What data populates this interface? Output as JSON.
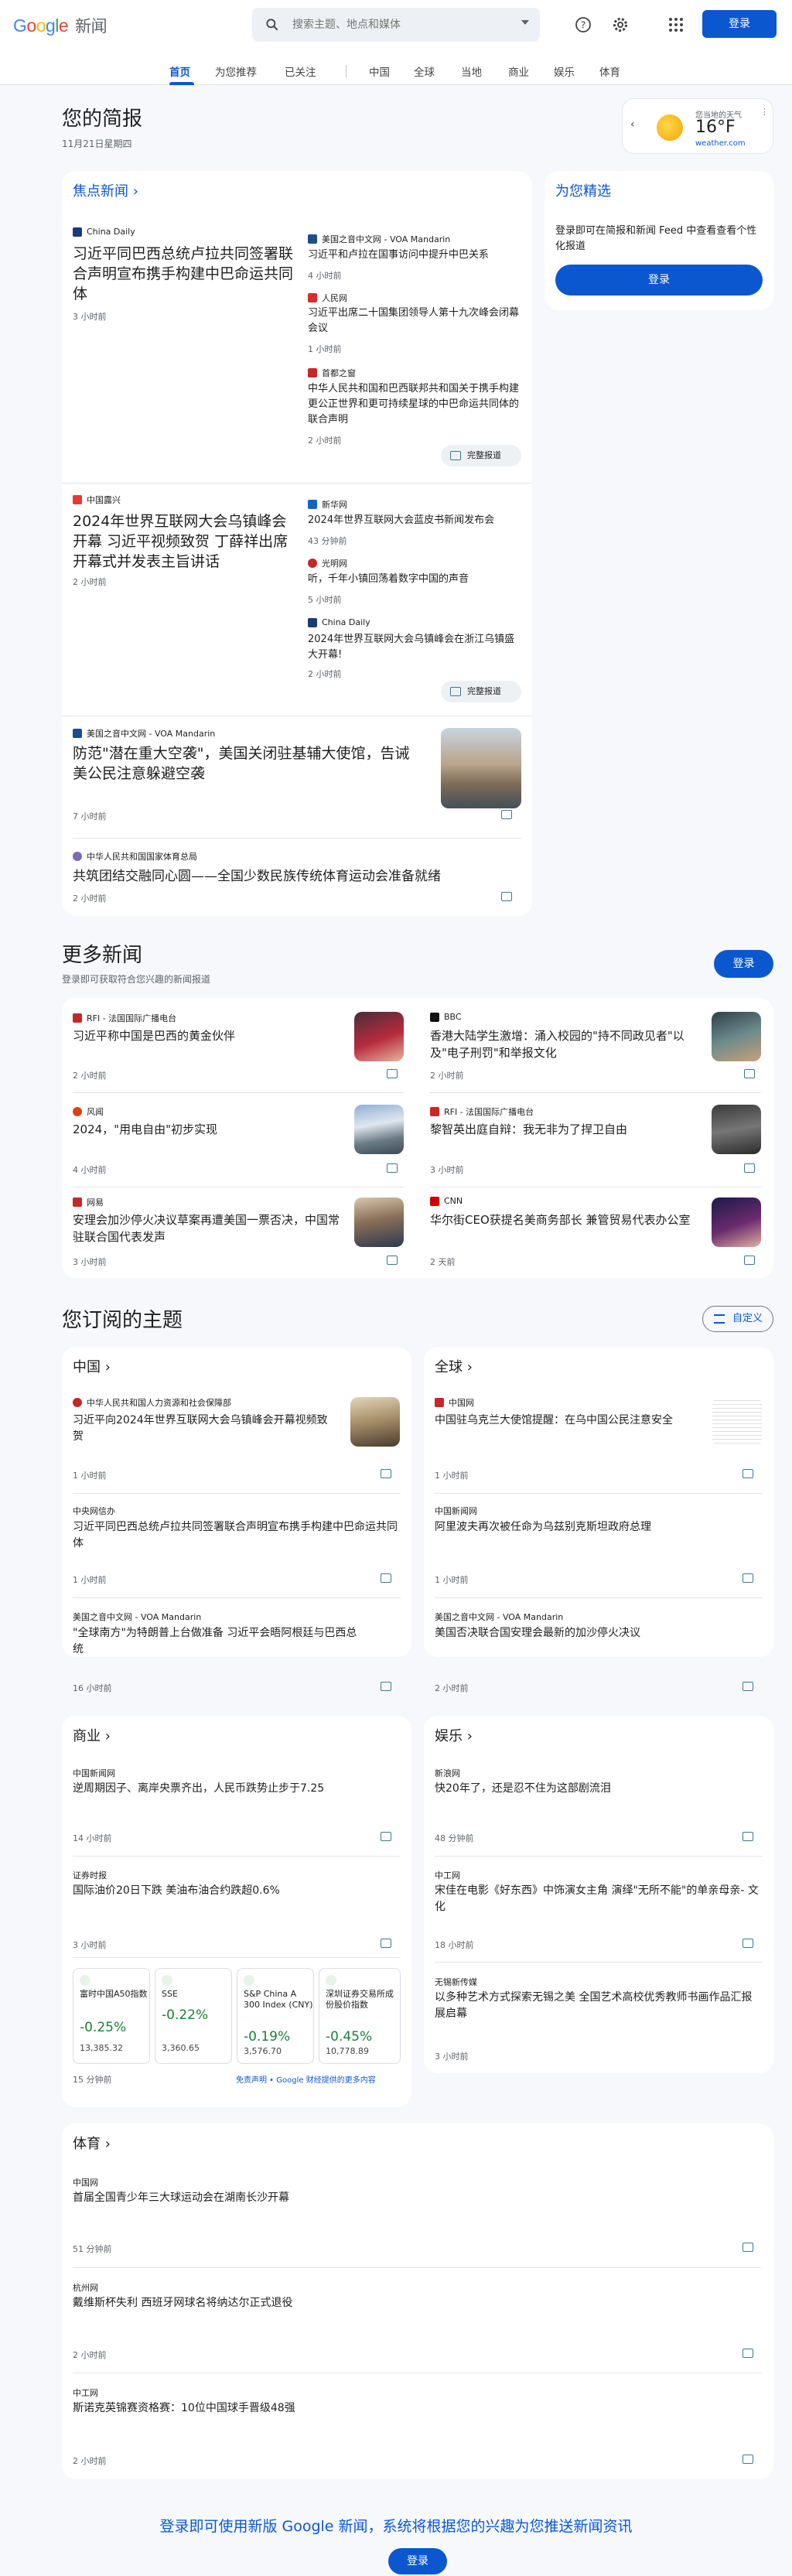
{
  "header": {
    "logo_word": "Google",
    "logo_name": "新闻",
    "search_placeholder": "搜索主题、地点和媒体",
    "signin": "登录"
  },
  "nav": [
    "首页",
    "为您推荐",
    "已关注",
    "中国",
    "全球",
    "当地",
    "商业",
    "娱乐",
    "体育"
  ],
  "briefing": {
    "title": "您的简报",
    "date": "11月21日星期四"
  },
  "weather": {
    "label": "您当地的天气",
    "temp": "16°F",
    "source": "weather.com"
  },
  "top": {
    "heading": "焦点新闻",
    "full_coverage": "完整报道",
    "c1": {
      "src": "China Daily",
      "title": "习近平同巴西总统卢拉共同签署联合声明宣布携手构建中巴命运共同体",
      "time": "3 小时前",
      "r": [
        {
          "src": "美国之音中文网 - VOA Mandarin",
          "title": "习近平和卢拉在国事访问中提升中巴关系",
          "time": "4 小时前"
        },
        {
          "src": "人民网",
          "title": "习近平出席二十国集团领导人第十九次峰会闭幕会议",
          "time": "1 小时前"
        },
        {
          "src": "首都之窗",
          "title": "中华人民共和国和巴西联邦共和国关于携手构建更公正世界和更可持续星球的中巴命运共同体的联合声明",
          "time": "2 小时前"
        }
      ]
    },
    "c2": {
      "src": "中国露兴",
      "title": "2024年世界互联网大会乌镇峰会开幕 习近平视频致贺 丁薛祥出席开幕式并发表主旨讲话",
      "time": "2 小时前",
      "r": [
        {
          "src": "新华网",
          "title": "2024年世界互联网大会蓝皮书新闻发布会",
          "time": "43 分钟前"
        },
        {
          "src": "光明网",
          "title": "听，千年小镇回荡着数字中国的声音",
          "time": "5 小时前"
        },
        {
          "src": "China Daily",
          "title": "2024年世界互联网大会乌镇峰会在浙江乌镇盛大开幕!",
          "time": "2 小时前"
        }
      ]
    },
    "c3": {
      "src": "美国之音中文网 - VOA Mandarin",
      "title": "防范\"潜在重大空袭\"，美国关闭驻基辅大使馆，告诫美公民注意躲避空袭",
      "time": "7 小时前"
    },
    "c4": {
      "src": "中华人民共和国国家体育总局",
      "title": "共筑团结交融同心圆——全国少数民族传统体育运动会准备就绪",
      "time": "2 小时前"
    }
  },
  "picks": {
    "title": "为您精选",
    "text": "登录即可在简报和新闻 Feed 中查看查看个性化报道",
    "btn": "登录"
  },
  "more": {
    "title": "更多新闻",
    "sub": "登录即可获取符合您兴趣的新闻报道",
    "btn": "登录",
    "items": [
      {
        "src": "RFI - 法国国际广播电台",
        "title": "习近平称中国是巴西的黄金伙伴",
        "time": "2 小时前"
      },
      {
        "src": "BBC",
        "title": "香港大陆学生激增：涌入校园的\"持不同政见者\"以及\"电子刑罚\"和举报文化",
        "time": "2 小时前"
      },
      {
        "src": "风闻",
        "title": "2024，\"用电自由\"初步实现",
        "time": "4 小时前"
      },
      {
        "src": "RFI - 法国国际广播电台",
        "title": "黎智英出庭自辩：我无非为了捍卫自由",
        "time": "3 小时前"
      },
      {
        "src": "网易",
        "title": "安理会加沙停火决议草案再遭美国一票否决，中国常驻联合国代表发声",
        "time": "3 小时前"
      },
      {
        "src": "CNN",
        "title": "华尔街CEO获提名美商务部长 兼管贸易代表办公室",
        "time": "2 天前"
      }
    ]
  },
  "topics": {
    "title": "您订阅的主题",
    "customize": "自定义",
    "china": {
      "title": "中国",
      "items": [
        {
          "src": "中华人民共和国人力资源和社会保障部",
          "title": "习近平向2024年世界互联网大会乌镇峰会开幕视频致贺",
          "time": "1 小时前"
        },
        {
          "src": "中央网信办",
          "title": "习近平同巴西总统卢拉共同签署联合声明宣布携手构建中巴命运共同体",
          "time": "1 小时前"
        },
        {
          "src": "美国之音中文网 - VOA Mandarin",
          "title": "\"全球南方\"为特朗普上台做准备 习近平会晤阿根廷与巴西总统",
          "time": "16 小时前"
        }
      ]
    },
    "world": {
      "title": "全球",
      "items": [
        {
          "src": "中国网",
          "title": "中国驻乌克兰大使馆提醒：在乌中国公民注意安全",
          "time": "1 小时前"
        },
        {
          "src": "中国新闻网",
          "title": "阿里波夫再次被任命为乌兹别克斯坦政府总理",
          "time": "1 小时前"
        },
        {
          "src": "美国之音中文网 - VOA Mandarin",
          "title": "美国否决联合国安理会最新的加沙停火决议",
          "time": "2 小时前"
        }
      ]
    },
    "biz": {
      "title": "商业",
      "items": [
        {
          "src": "中国新闻网",
          "title": "逆周期因子、离岸央票齐出，人民币跌势止步于7.25",
          "time": "14 小时前"
        },
        {
          "src": "证券时报",
          "title": "国际油价20日下跌 美油布油合约跌超0.6%",
          "time": "3 小时前"
        }
      ],
      "markets": [
        {
          "name": "富时中国A50指数",
          "pct": "-0.25%",
          "val": "13,385.32"
        },
        {
          "name": "SSE",
          "pct": "-0.22%",
          "val": "3,360.65"
        },
        {
          "name": "S&P China A 300 Index (CNY)",
          "pct": "-0.19%",
          "val": "3,576.70"
        },
        {
          "name": "深圳证券交易所成份股价指数",
          "pct": "-0.45%",
          "val": "10,778.89"
        }
      ],
      "mtime": "15 分钟前",
      "disclaimer": "免责声明 • Google 财经提供的更多内容"
    },
    "ent": {
      "title": "娱乐",
      "items": [
        {
          "src": "新浪网",
          "title": "快20年了，还是忍不住为这部剧流泪",
          "time": "48 分钟前"
        },
        {
          "src": "中工网",
          "title": "宋佳在电影《好东西》中饰演女主角 演绎\"无所不能\"的单亲母亲- 文化",
          "time": "18 小时前"
        },
        {
          "src": "无锡新传媒",
          "title": "以多种艺术方式探索无锡之美 全国艺术高校优秀教师书画作品汇报展启幕",
          "time": "3 小时前"
        }
      ]
    },
    "sports": {
      "title": "体育",
      "items": [
        {
          "src": "中国网",
          "title": "首届全国青少年三大球运动会在湖南长沙开幕",
          "time": "51 分钟前"
        },
        {
          "src": "杭州网",
          "title": "戴维斯杯失利 西班牙网球名将纳达尔正式退役",
          "time": "2 小时前"
        },
        {
          "src": "中工网",
          "title": "斯诺克英锦赛资格赛：10位中国球手晋级48强",
          "time": "2 小时前"
        }
      ]
    }
  },
  "footer": {
    "text": "登录即可使用新版 Google 新闻，系统将根据您的兴趣为您推送新闻资讯",
    "btn": "登录"
  }
}
